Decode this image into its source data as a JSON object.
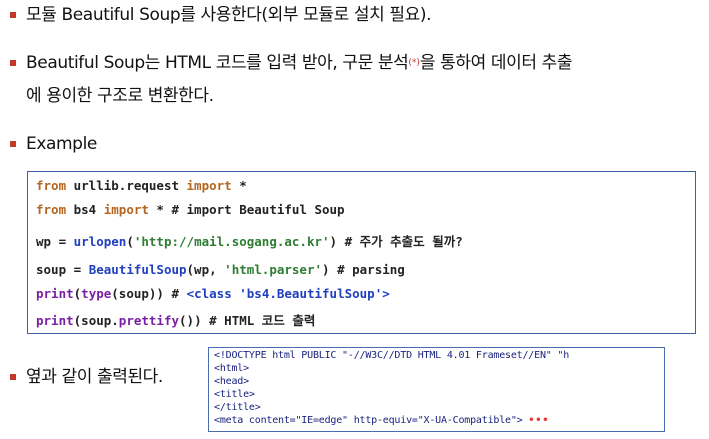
{
  "bullets": {
    "b1": "모듈 Beautiful Soup를 사용한다(외부 모듈로 설치 필요).",
    "b2_line1_a": "Beautiful Soup는 HTML 코드를 입력 받아, 구문 분석",
    "b2_sup": "(*)",
    "b2_line1_b": "을 통하여 데이터 추출",
    "b2_line2": "에 용이한 구조로 변환한다.",
    "b3": "Example",
    "b4": "옆과 같이 출력된다."
  },
  "code": {
    "l1": {
      "k1": "from",
      "t1": " urllib.request ",
      "k2": "import",
      "t2": " *"
    },
    "l2": {
      "k1": "from",
      "t1": " bs4 ",
      "k2": "import",
      "t2": " *  ",
      "c": "# import Beautiful Soup"
    },
    "l3": {
      "t1": "wp = ",
      "f": "urlopen",
      "t2": "(",
      "s": "'http://mail.sogang.ac.kr'",
      "t3": ") ",
      "c": "# 주가 추출도 될까?"
    },
    "l4": {
      "t1": "soup = ",
      "f": "BeautifulSoup",
      "t2": "(wp, ",
      "s": "'html.parser'",
      "t3": ") ",
      "c": "# parsing"
    },
    "l5": {
      "b1": "print",
      "t1": "(",
      "b2": "type",
      "t2": "(soup))  ",
      "c1": "# ",
      "f": "<class 'bs4.BeautifulSoup'>"
    },
    "l6": {
      "b1": "print",
      "t1": "(soup.",
      "b2": "prettify",
      "t2": "()) ",
      "c": "# HTML 코드 출력"
    }
  },
  "output": {
    "lines": [
      "<!DOCTYPE html PUBLIC \"-//W3C//DTD HTML 4.01 Frameset//EN\" \"h",
      "<html>",
      " <head>",
      "  <title>",
      "  </title>",
      "  <meta content=\"IE=edge\" http-equiv=\"X-UA-Compatible\">"
    ],
    "ellipsis": "•••"
  }
}
